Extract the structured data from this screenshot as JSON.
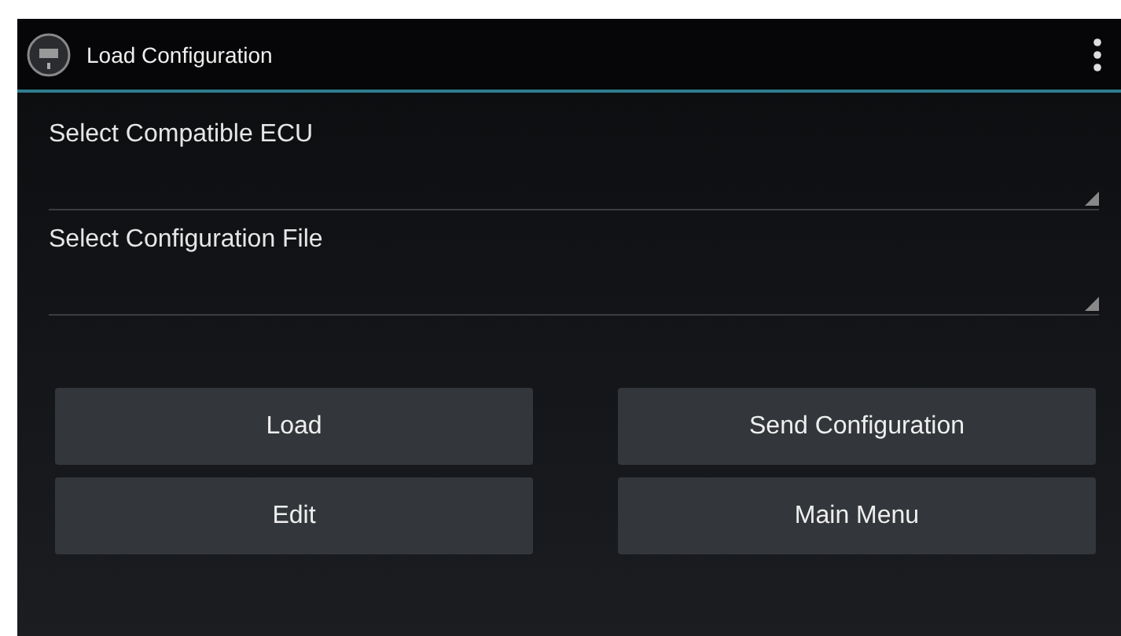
{
  "app_bar": {
    "title": "Load Configuration"
  },
  "spinners": [
    {
      "label": "Select Compatible ECU"
    },
    {
      "label": "Select Configuration File"
    }
  ],
  "buttons": [
    "Load",
    "Send Configuration",
    "Edit",
    "Main Menu"
  ]
}
